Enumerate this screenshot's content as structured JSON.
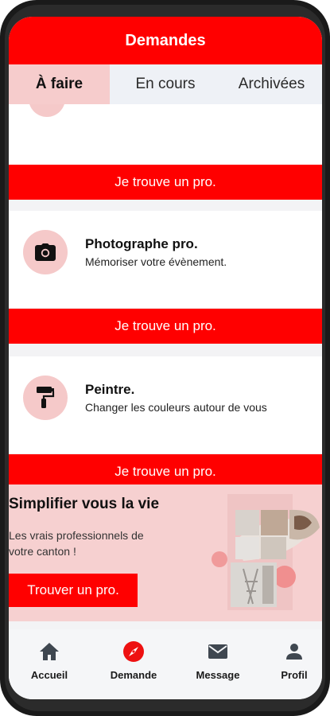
{
  "header": {
    "title": "Demandes"
  },
  "tabs": [
    {
      "label": "À faire",
      "active": true
    },
    {
      "label": "En cours",
      "active": false
    },
    {
      "label": "Archivées",
      "active": false
    }
  ],
  "cta_label": "Je trouve un pro.",
  "services": [
    {
      "title": "Photographe pro.",
      "description": "Mémoriser votre évènement.",
      "icon": "camera-icon"
    },
    {
      "title": "Peintre.",
      "description": "Changer les couleurs autour de vous",
      "icon": "paint-roller-icon"
    }
  ],
  "promo": {
    "title": "Simplifier vous la vie",
    "text": "Les vrais professionnels de votre canton !",
    "button": "Trouver un pro."
  },
  "bottom_nav": [
    {
      "label": "Accueil",
      "icon": "home-icon"
    },
    {
      "label": "Demande",
      "icon": "compass-icon",
      "active": true
    },
    {
      "label": "Message",
      "icon": "mail-icon"
    },
    {
      "label": "Profil",
      "icon": "user-icon"
    }
  ],
  "colors": {
    "primary": "#ff0000",
    "accent_light": "#f5c9c9",
    "dark": "#1a1a1a"
  }
}
